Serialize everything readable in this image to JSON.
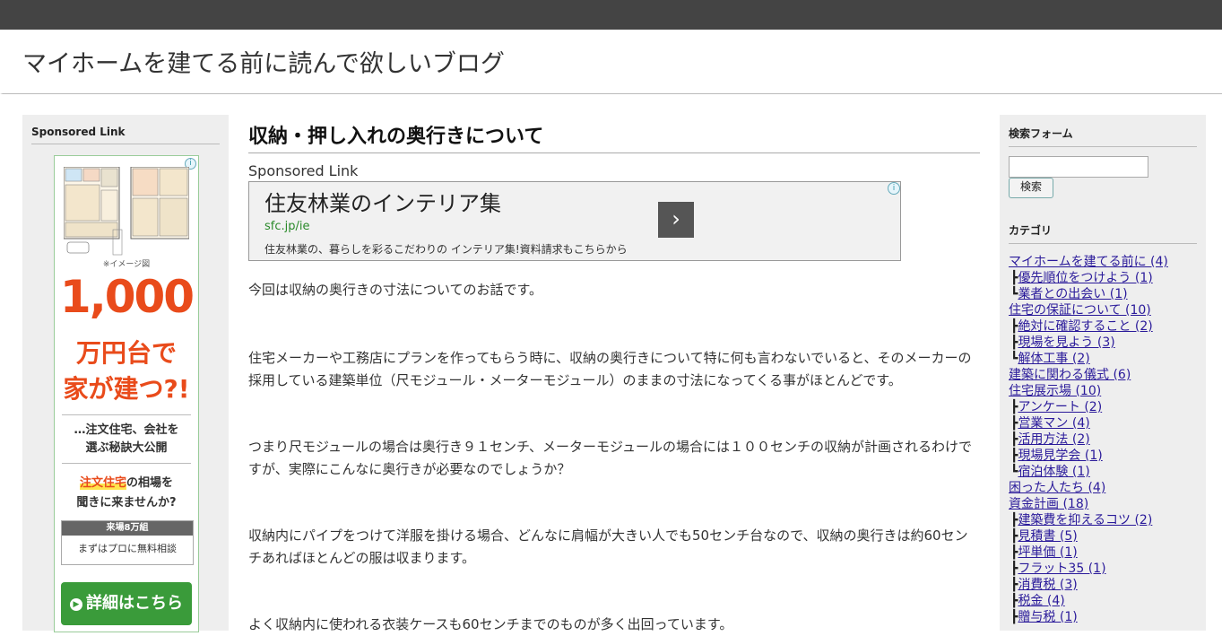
{
  "site": {
    "title": "マイホームを建てる前に読んで欲しいブログ"
  },
  "left_sidebar": {
    "heading": "Sponsored Link",
    "ad": {
      "caption": "※イメージ図",
      "headline_number": "1,000",
      "headline_line1": "万円台で",
      "headline_line2": "家が建つ?!",
      "sub1": "…注文住宅、会社を",
      "sub2": "選ぶ秘訣大公開",
      "q_highlight": "注文住宅",
      "q_rest": "の相場を",
      "q_line2": "聞きに来ませんか?",
      "box_top": "来場8万組",
      "box_bottom": "まずはプロに無料相談",
      "button": "詳細はこちら"
    }
  },
  "post": {
    "title": "収納・押し入れの奥行きについて",
    "sponsored_label": "Sponsored Link",
    "text_ad": {
      "title": "住友林業のインテリア集",
      "url": "sfc.jp/ie",
      "description": "住友林業の、暮らしを彩るこだわりの インテリア集!資料請求もこちらから"
    },
    "paragraphs": [
      "今回は収納の奥行きの寸法についてのお話です。",
      "住宅メーカーや工務店にプランを作ってもらう時に、収納の奥行きについて特に何も言わないでいると、そのメーカーの採用している建築単位（尺モジュール・メーターモジュール）のままの寸法になってくる事がほとんどです。",
      "つまり尺モジュールの場合は奥行き９１センチ、メーターモジュールの場合には１００センチの収納が計画されるわけですが、実際にこんなに奥行きが必要なのでしょうか？",
      "収納内にパイプをつけて洋服を掛ける場合、どんなに肩幅が大きい人でも50センチ台なので、収納の奥行きは約60センチあればほとんどの服は収まります。",
      "よく収納内に使われる衣装ケースも60センチまでのものが多く出回っています。"
    ]
  },
  "right_sidebar": {
    "search_heading": "検索フォーム",
    "search_button": "検索",
    "search_value": "",
    "category_heading": "カテゴリ",
    "categories": [
      {
        "prefix": "",
        "label": "マイホームを建てる前に (4)"
      },
      {
        "prefix": "┣",
        "label": "優先順位をつけよう (1)"
      },
      {
        "prefix": "┗",
        "label": "業者との出会い (1)"
      },
      {
        "prefix": "",
        "label": "住宅の保証について (10)"
      },
      {
        "prefix": "┣",
        "label": "絶対に確認すること (2)"
      },
      {
        "prefix": "┣",
        "label": "現場を見よう (3)"
      },
      {
        "prefix": "┗",
        "label": "解体工事 (2)"
      },
      {
        "prefix": "",
        "label": "建築に関わる儀式 (6)"
      },
      {
        "prefix": "",
        "label": "住宅展示場 (10)"
      },
      {
        "prefix": "┣",
        "label": "アンケート (2)"
      },
      {
        "prefix": "┣",
        "label": "営業マン (4)"
      },
      {
        "prefix": "┣",
        "label": "活用方法 (2)"
      },
      {
        "prefix": "┣",
        "label": "現場見学会 (1)"
      },
      {
        "prefix": "┗",
        "label": "宿泊体験 (1)"
      },
      {
        "prefix": "",
        "label": "困った人たち (4)"
      },
      {
        "prefix": "",
        "label": "資金計画 (18)"
      },
      {
        "prefix": "┣",
        "label": "建築費を抑えるコツ (2)"
      },
      {
        "prefix": "┣",
        "label": "見積書 (5)"
      },
      {
        "prefix": "┣",
        "label": "坪単価 (1)"
      },
      {
        "prefix": "┣",
        "label": "フラット35 (1)"
      },
      {
        "prefix": "┣",
        "label": "消費税 (3)"
      },
      {
        "prefix": "┣",
        "label": "税金 (4)"
      },
      {
        "prefix": "┣",
        "label": "贈与税 (1)"
      }
    ]
  }
}
